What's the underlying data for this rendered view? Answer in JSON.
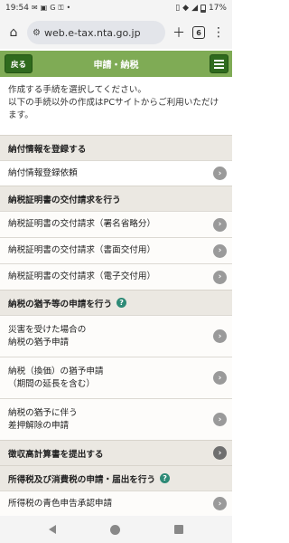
{
  "status": {
    "time": "19:54",
    "battery": "17%"
  },
  "browser": {
    "url": "web.e-tax.nta.go.jp",
    "tab_count": "6"
  },
  "header": {
    "back_label": "戻る",
    "title": "申請・納税"
  },
  "intro": {
    "line1": "作成する手続を選択してください。",
    "line2": "以下の手続以外の作成はPCサイトからご利用いただけます。"
  },
  "sections": {
    "s1": {
      "title": "納付情報を登録する"
    },
    "s1_items": [
      {
        "label": "納付情報登録依頼"
      }
    ],
    "s2": {
      "title": "納税証明書の交付請求を行う"
    },
    "s2_items": [
      {
        "label": "納税証明書の交付請求（署名省略分）"
      },
      {
        "label": "納税証明書の交付請求（書面交付用）"
      },
      {
        "label": "納税証明書の交付請求（電子交付用）"
      }
    ],
    "s3": {
      "title": "納税の猶予等の申請を行う"
    },
    "s3_items": [
      {
        "line1": "災害を受けた場合の",
        "line2": "納税の猶予申請"
      },
      {
        "line1": "納税（換価）の猶予申請",
        "line2": "（期間の延長を含む）"
      },
      {
        "line1": "納税の猶予に伴う",
        "line2": "差押解除の申請"
      }
    ],
    "s4": {
      "title": "徴収高計算書を提出する"
    },
    "s5": {
      "title": "所得税及び消費税の申請・届出を行う"
    },
    "s5_items": [
      {
        "label": "所得税の青色申告承認申請"
      }
    ]
  },
  "icons": {
    "help": "?",
    "arrow": "›"
  },
  "colors": {
    "header_green": "#7fab55",
    "button_green": "#2f6a1d",
    "help_teal": "#2e8a76"
  }
}
